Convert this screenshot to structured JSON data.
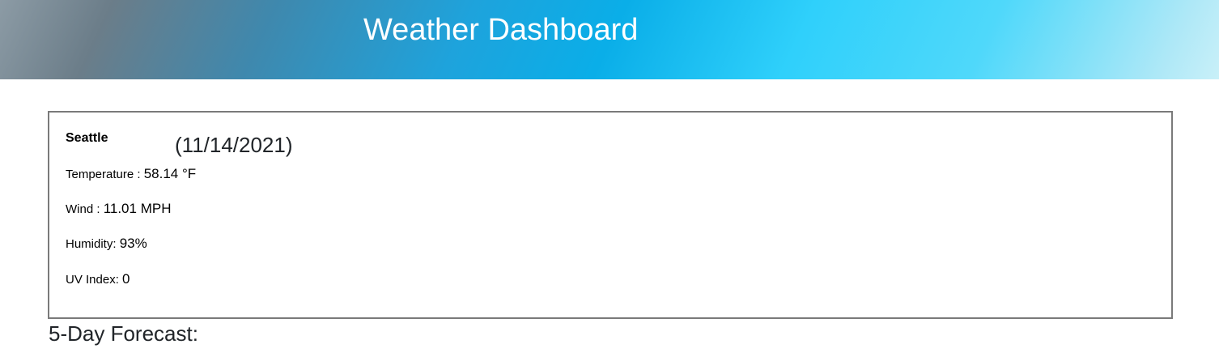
{
  "header": {
    "title": "Weather Dashboard"
  },
  "current": {
    "city": "Seattle",
    "date": "(11/14/2021)",
    "temperature": {
      "label": "Temperature : ",
      "value": "58.14 °F"
    },
    "wind": {
      "label": "Wind : ",
      "value": "11.01 MPH"
    },
    "humidity": {
      "label": "Humidity: ",
      "value": "93%"
    },
    "uv_index": {
      "label": "UV Index: ",
      "value": "0"
    }
  },
  "forecast": {
    "title": "5-Day Forecast:"
  },
  "colors": {
    "header_gradient_start": "#8c9ba5",
    "header_gradient_mid": "#0aaee8",
    "header_gradient_end": "#c9f0f8",
    "card_border": "#7a7a7a"
  }
}
